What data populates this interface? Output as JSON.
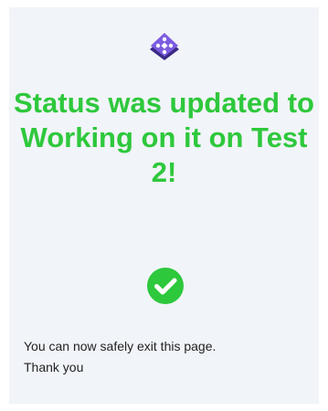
{
  "colors": {
    "success": "#2ec83c",
    "logo_purple": "#6f52c8",
    "card_bg": "#f1f4f9"
  },
  "icons": {
    "logo": "app-logo-icon",
    "status": "check-circle-icon"
  },
  "status_message": {
    "title": "Status was updated to Working on it on Test 2!",
    "line1": "You can now safely exit this page.",
    "line2": "Thank you"
  }
}
